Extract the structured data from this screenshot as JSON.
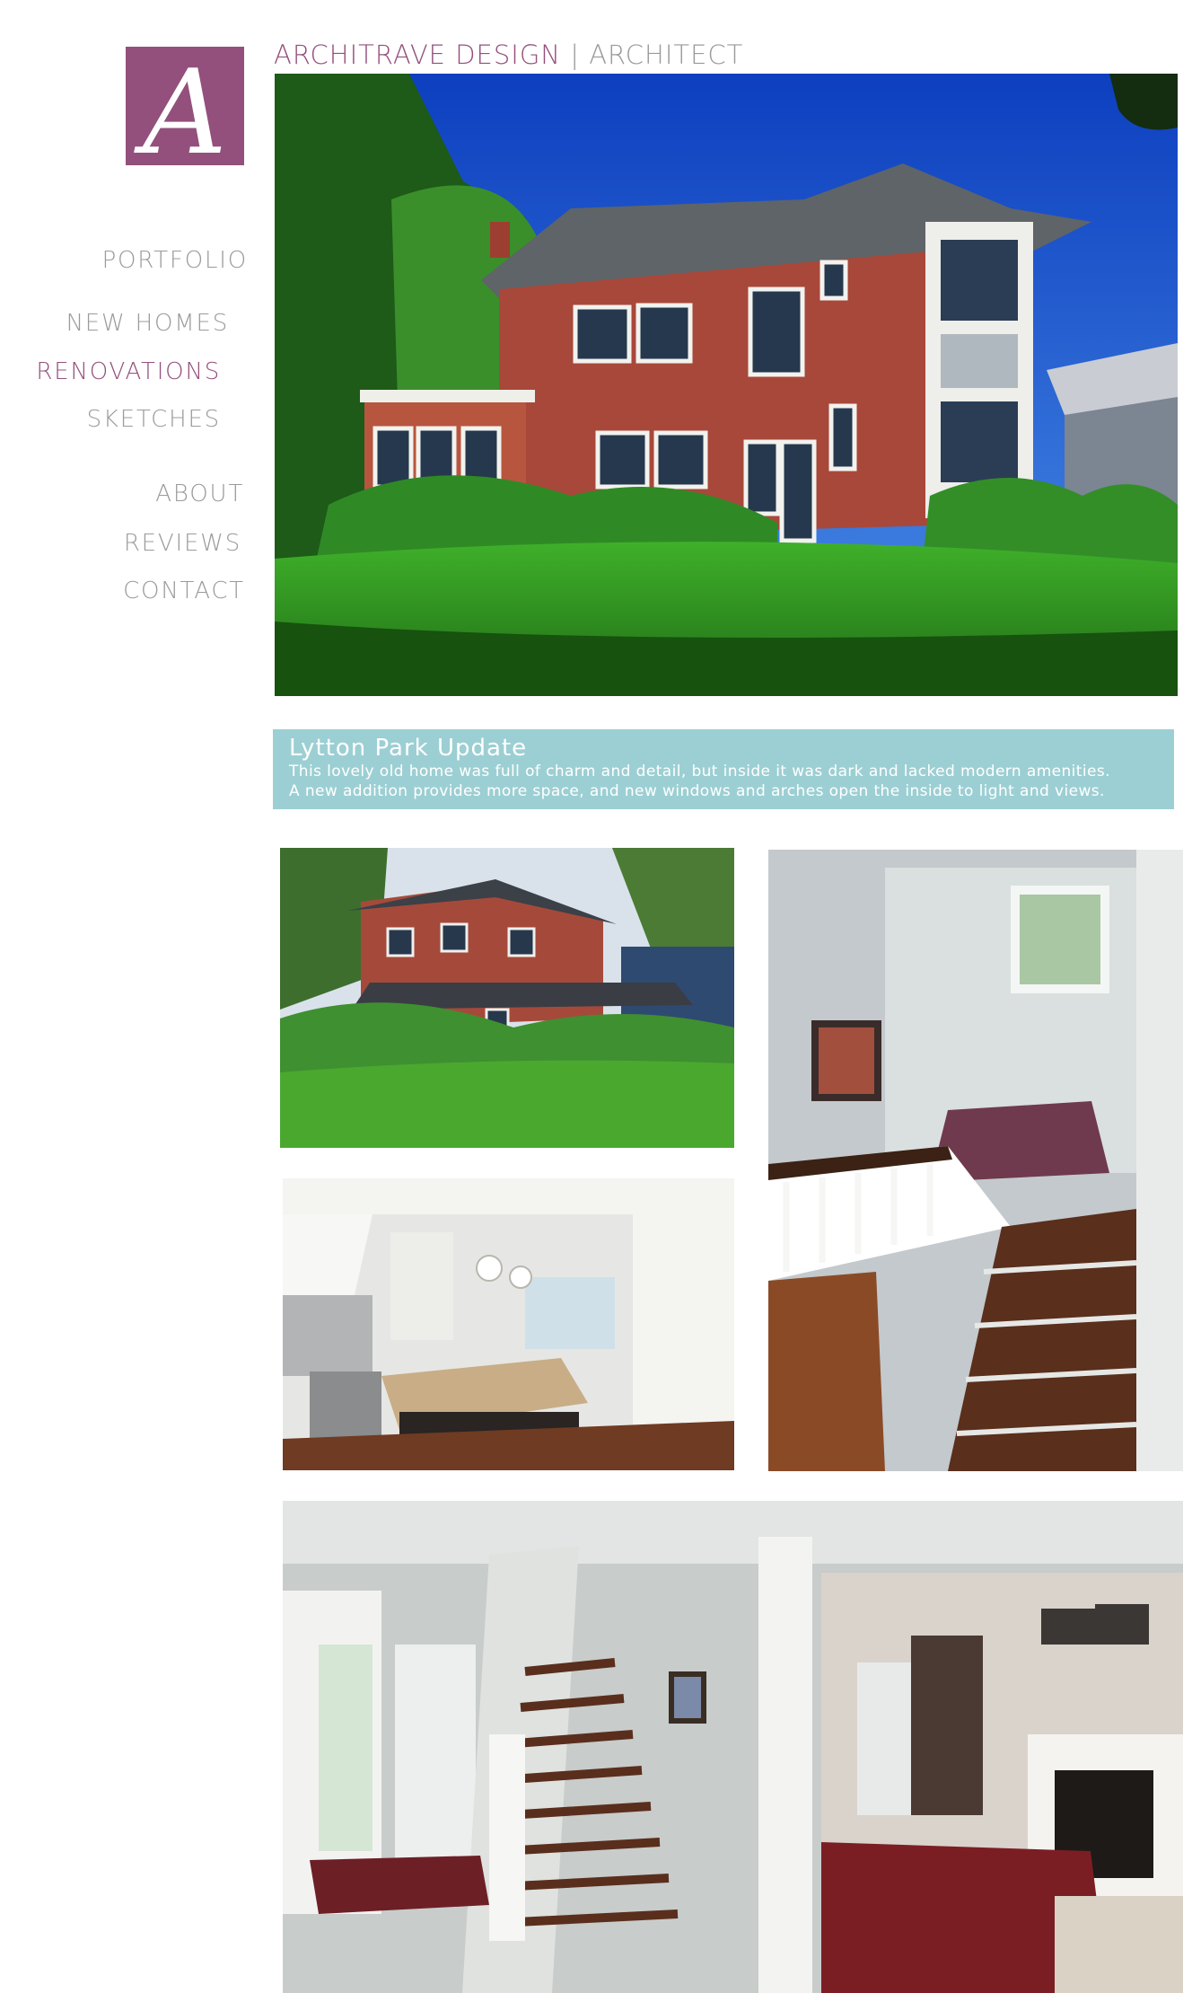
{
  "header": {
    "brand": "ARCHITRAVE DESIGN",
    "separator": "|",
    "role": "ARCHITECT"
  },
  "logo": {
    "letter": "A",
    "color": "#93507c"
  },
  "nav": {
    "items": [
      {
        "label": "PORTFOLIO",
        "active": false
      },
      {
        "label": "NEW HOMES",
        "active": false
      },
      {
        "label": "RENOVATIONS",
        "active": true
      },
      {
        "label": "SKETCHES",
        "active": false
      },
      {
        "label": "ABOUT",
        "active": false
      },
      {
        "label": "REVIEWS",
        "active": false
      },
      {
        "label": "CONTACT",
        "active": false
      }
    ]
  },
  "project": {
    "title": "Lytton Park Update",
    "description_line1": "This lovely old home was full of charm and detail, but inside it was dark and lacked modern amenities.",
    "description_line2": "A new addition provides more space, and new windows and arches open the inside to light and views."
  },
  "colors": {
    "accent": "#93507c",
    "nav_text": "#9b9b9b",
    "caption_bg": "#9ccfd3",
    "caption_text": "#ffffff"
  }
}
